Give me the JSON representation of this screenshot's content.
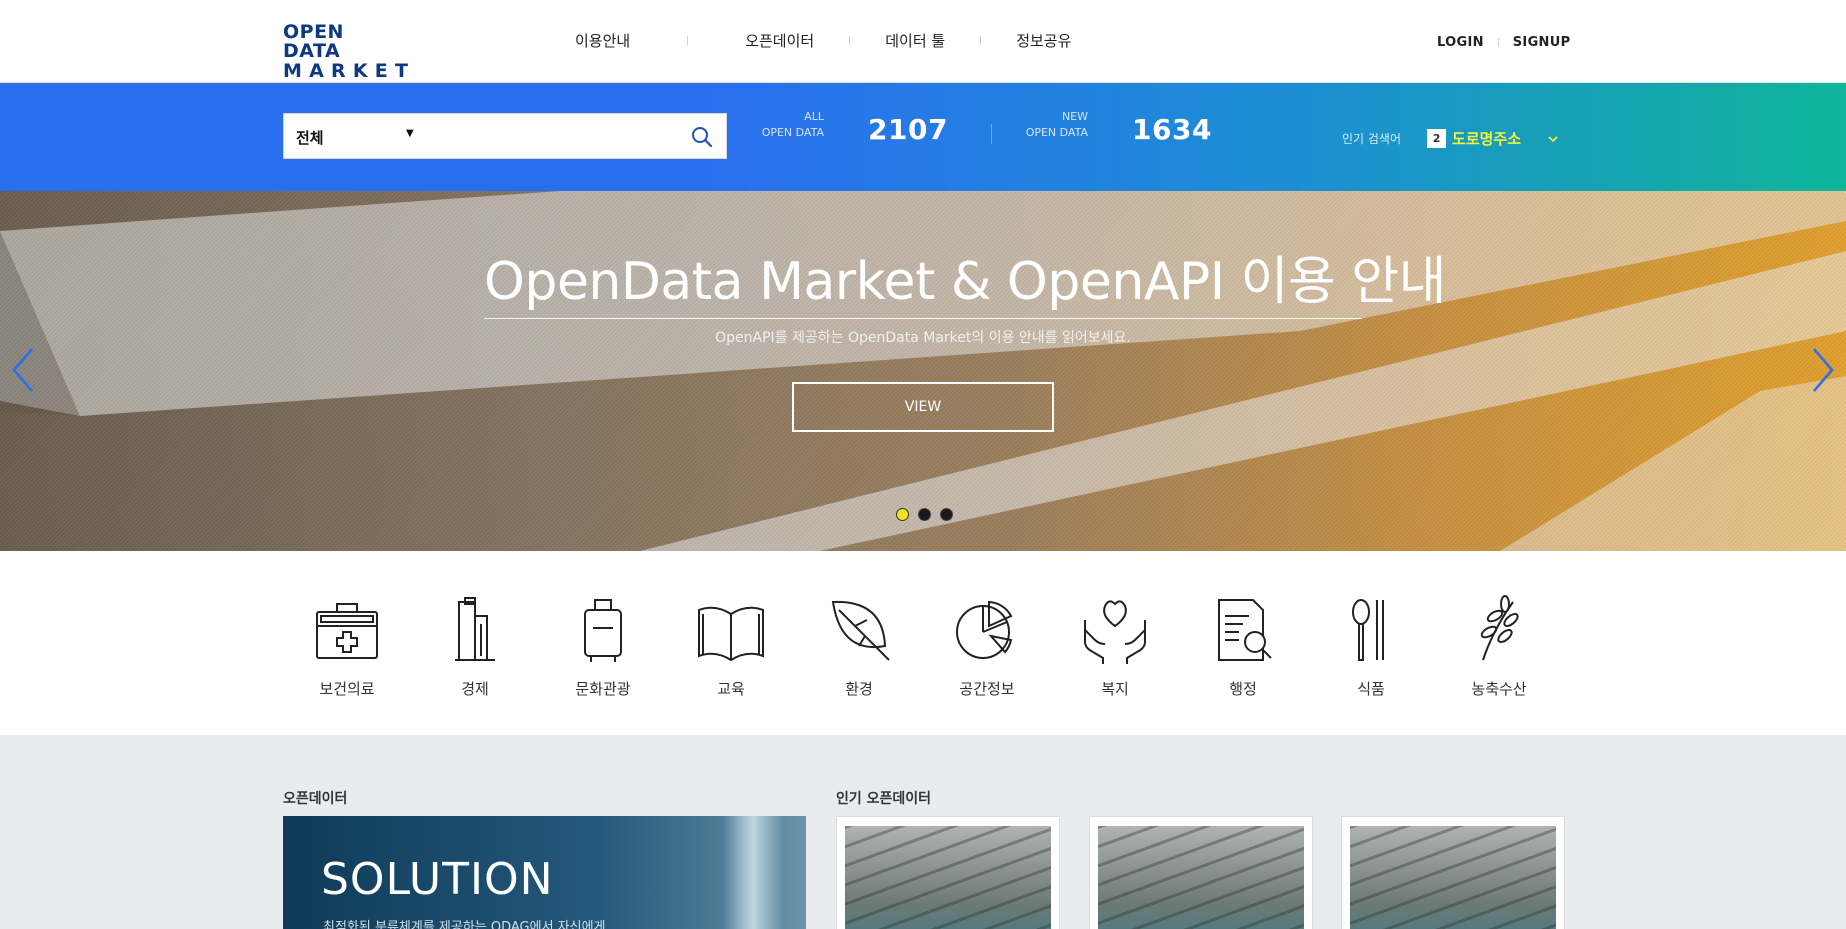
{
  "header": {
    "logo_line1": "OPEN DATA",
    "logo_line2": "MARKET",
    "nav": [
      "이용안내",
      "오픈데이터",
      "데이터 툴",
      "정보공유"
    ],
    "login": "LOGIN",
    "signup": "SIGNUP"
  },
  "search": {
    "category": "전체",
    "placeholder": ""
  },
  "stats": {
    "all_label_1": "ALL",
    "all_label_2": "OPEN DATA",
    "all_value": "2107",
    "new_label_1": "NEW",
    "new_label_2": "OPEN DATA",
    "new_value": "1634"
  },
  "popular": {
    "label": "인기 검색어",
    "rank": "2",
    "keyword": "도로명주소"
  },
  "hero": {
    "title": "OpenData Market & OpenAPI 이용 안내",
    "subtitle": "OpenAPI를 제공하는 OpenData Market의 이용 안내를 읽어보세요.",
    "button": "VIEW",
    "active_slide": 1,
    "slide_count": 3
  },
  "categories": [
    {
      "label": "보건의료",
      "icon": "medical-kit-icon"
    },
    {
      "label": "경제",
      "icon": "buildings-icon"
    },
    {
      "label": "문화관광",
      "icon": "suitcase-icon"
    },
    {
      "label": "교육",
      "icon": "book-icon"
    },
    {
      "label": "환경",
      "icon": "leaf-icon"
    },
    {
      "label": "공간정보",
      "icon": "pie-chart-icon"
    },
    {
      "label": "복지",
      "icon": "heart-hands-icon"
    },
    {
      "label": "행정",
      "icon": "document-search-icon"
    },
    {
      "label": "식품",
      "icon": "utensils-icon"
    },
    {
      "label": "농축수산",
      "icon": "wheat-icon"
    }
  ],
  "sections": {
    "open_data_title": "오픈데이터",
    "popular_title": "인기 오픈데이터",
    "solution_title": "SOLUTION",
    "solution_desc": "최적화된 분류체계를 제공하는 ODAG에서 자신에게"
  },
  "colors": {
    "brand": "#0b3a80",
    "band_start": "#2a6ef0",
    "band_end": "#10b59a",
    "keyword": "#f5f53a",
    "active_dot": "#f0e41f"
  }
}
